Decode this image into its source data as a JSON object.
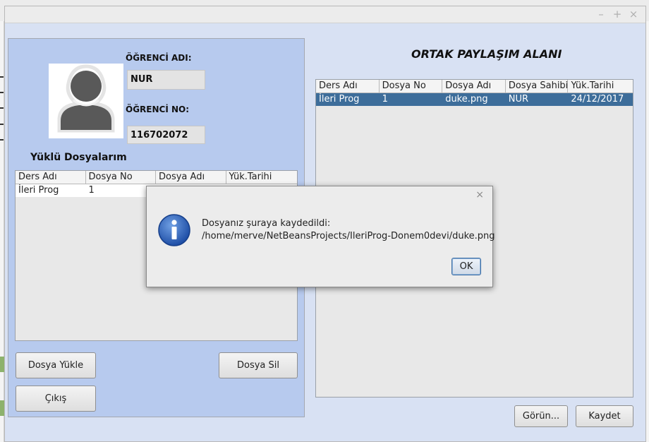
{
  "left_panel": {
    "student_name_label": "ÖĞRENCİ ADI:",
    "student_name_value": "NUR",
    "student_no_label": "ÖĞRENCİ NO:",
    "student_no_value": "116702072",
    "my_files_title": "Yüklü Dosyalarım",
    "table": {
      "columns": [
        "Ders Adı",
        "Dosya No",
        "Dosya Adı",
        "Yük.Tarihi"
      ],
      "rows": [
        [
          "İleri Prog",
          "1",
          "",
          ""
        ]
      ]
    },
    "upload_button": "Dosya Yükle",
    "delete_button": "Dosya Sil",
    "exit_button": "Çıkış"
  },
  "right_panel": {
    "title": "ORTAK PAYLAŞIM ALANI",
    "table": {
      "columns": [
        "Ders Adı",
        "Dosya No",
        "Dosya Adı",
        "Dosya Sahibi",
        "Yük.Tarihi"
      ],
      "rows": [
        [
          "İleri Prog",
          "1",
          "duke.png",
          "NUR",
          "24/12/2017"
        ]
      ]
    },
    "view_button": "Görün...",
    "save_button": "Kaydet"
  },
  "window_controls": {
    "minimize": "–",
    "maximize": "+",
    "close": "×"
  },
  "dialog": {
    "close": "×",
    "message_line1": "Dosyanız şuraya kaydedildi:",
    "message_line2": "/home/merve/NetBeansProjects/IleriProg-Donem0devi/duke.png",
    "ok_button": "OK",
    "icon": "info-icon"
  },
  "colors": {
    "left_panel_bg": "#b7caee",
    "window_bg": "#d8e1f3",
    "selected_row": "#3d6d9a",
    "info_icon": "#2a5db0"
  }
}
